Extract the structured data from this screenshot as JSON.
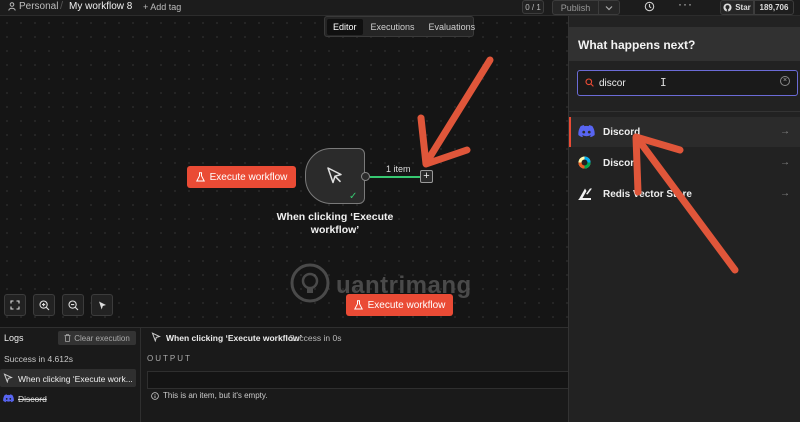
{
  "header": {
    "workspace": "Personal",
    "separator": "/",
    "workflow_title": "My workflow 8",
    "add_tag": "+ Add tag",
    "version": "0 / 1",
    "publish_label": "Publish",
    "github_label": "Star",
    "star_count": "189,706"
  },
  "view_tabs": [
    {
      "label": "Editor",
      "active": true
    },
    {
      "label": "Executions",
      "active": false
    },
    {
      "label": "Evaluations",
      "active": false
    }
  ],
  "canvas": {
    "execute_button": "Execute workflow",
    "execute_button_bottom": "Execute workflow",
    "connection_label": "1 item",
    "trigger_node_title": "When clicking ‘Execute workflow’",
    "watermark": "uantrimang"
  },
  "logs": {
    "title": "Logs",
    "clear_button": "Clear execution",
    "success_text": "Success in 4.612s",
    "entries": [
      {
        "label": "When clicking ‘Execute work...",
        "icon": "cursor-icon",
        "selected": true
      },
      {
        "label": "Discord",
        "icon": "discord-icon",
        "selected": false
      }
    ],
    "detail_title": "When clicking ‘Execute workflow’",
    "detail_status": "Success in 0s",
    "output_label": "OUTPUT",
    "empty_message": "This is an item, but it's empty."
  },
  "side_panel": {
    "title": "What happens next?",
    "search_value": "discor",
    "results": [
      {
        "label": "Discord",
        "icon": "discord-icon"
      },
      {
        "label": "Discord",
        "icon": "discourse-icon"
      },
      {
        "label": "Redis Vector Store",
        "icon": "redis-icon"
      }
    ]
  },
  "colors": {
    "accent": "#ea4b35",
    "success": "#37c871",
    "search_focus": "#6b6bd6",
    "discord": "#5865f2"
  }
}
